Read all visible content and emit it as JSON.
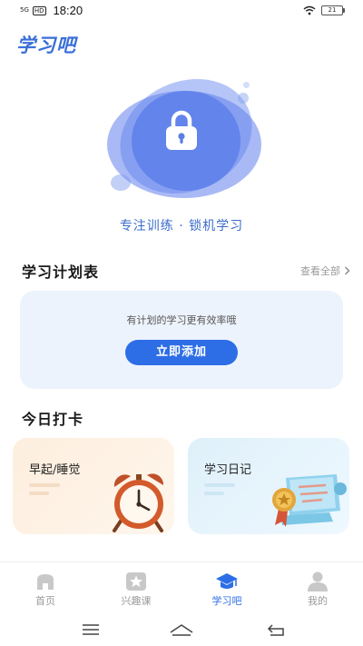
{
  "status_bar": {
    "signal": "5G",
    "hd": "HD",
    "time": "18:20",
    "battery": "21"
  },
  "app": {
    "title": "学习吧"
  },
  "hero": {
    "caption": "专注训练 · 锁机学习",
    "icon": "lock-icon",
    "accent": "#3b6cc9"
  },
  "plan": {
    "title": "学习计划表",
    "view_all": "查看全部",
    "hint": "有计划的学习更有效率哦",
    "add_button": "立即添加",
    "button_color": "#2d6ee6"
  },
  "checkin": {
    "title": "今日打卡",
    "cards": [
      {
        "label": "早起/睡觉",
        "icon": "alarm-clock-icon"
      },
      {
        "label": "学习日记",
        "icon": "certificate-scroll-icon"
      }
    ]
  },
  "bottom_nav": {
    "active_color": "#2d6ee6",
    "items": [
      {
        "label": "首页",
        "icon": "home-icon",
        "active": false
      },
      {
        "label": "兴趣课",
        "icon": "star-icon",
        "active": false
      },
      {
        "label": "学习吧",
        "icon": "graduation-cap-icon",
        "active": true
      },
      {
        "label": "我的",
        "icon": "person-icon",
        "active": false
      }
    ]
  },
  "system_nav": {
    "icons": [
      "menu-icon",
      "home-outline-icon",
      "back-icon"
    ]
  }
}
